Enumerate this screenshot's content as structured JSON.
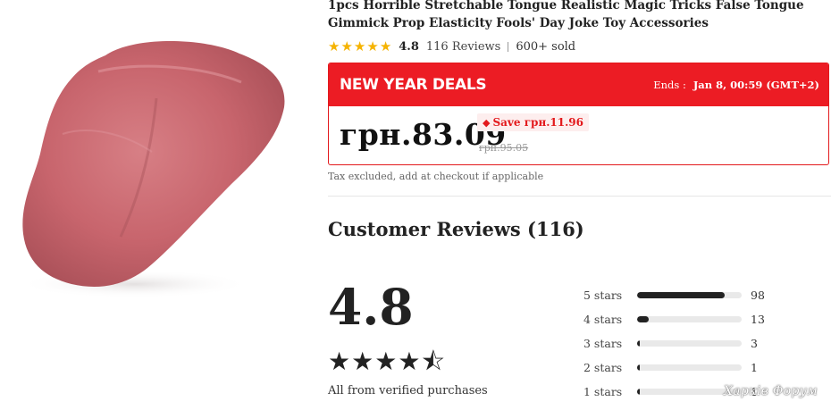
{
  "product": {
    "title": "1pcs Horrible Stretchable Tongue Realistic Magic Tricks False Tongue Gimmick Prop Elasticity Fools' Day Joke Toy Accessories",
    "rating": "4.8",
    "reviews_link": "116 Reviews",
    "sold": "600+ sold",
    "rating_value": 4.8,
    "star_color": "#f5b301"
  },
  "deal": {
    "label": "NEW YEAR DEALS",
    "ends_label": "Ends :",
    "ends_value": "Jan 8, 00:59 (GMT+2)",
    "price": "грн.83.09",
    "save": "Save грн.11.96",
    "old_price": "грн.95.05",
    "accent_color": "#ec1c24",
    "tag_icon": "tag-icon"
  },
  "tax_note": "Tax excluded, add at checkout if applicable",
  "reviews": {
    "title": "Customer Reviews (116)",
    "average": "4.8",
    "verified": "All from verified purchases",
    "distribution": [
      {
        "label": "5 stars",
        "count": "98",
        "fraction": 0.838
      },
      {
        "label": "4 stars",
        "count": "13",
        "fraction": 0.111
      },
      {
        "label": "3 stars",
        "count": "3",
        "fraction": 0.026
      },
      {
        "label": "2 stars",
        "count": "1",
        "fraction": 0.009
      },
      {
        "label": "1 stars",
        "count": "1",
        "fraction": 0.009
      }
    ]
  },
  "watermark": "Харків Форум"
}
